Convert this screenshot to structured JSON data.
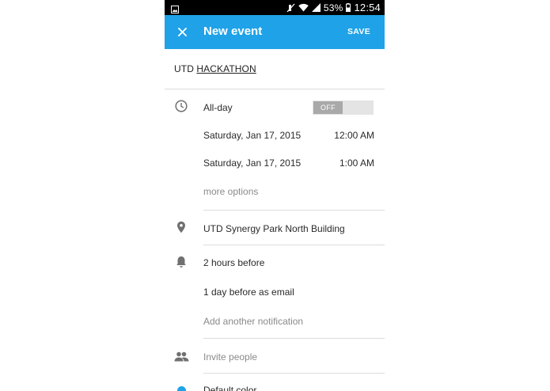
{
  "status_bar": {
    "battery_percent": "53%",
    "time": "12:54",
    "icons": [
      "image-icon",
      "mute-icon",
      "wifi-icon",
      "signal-icon",
      "battery-icon"
    ]
  },
  "app_bar": {
    "close_icon": "close-icon",
    "title": "New event",
    "save_label": "SAVE",
    "background_color": "#1fa2e8"
  },
  "event": {
    "title_prefix": "UTD ",
    "title_underlined": "HACKATHON"
  },
  "time_section": {
    "icon": "clock-icon",
    "all_day_label": "All-day",
    "all_day_toggle": "OFF",
    "start_date": "Saturday, Jan 17, 2015",
    "start_time": "12:00 AM",
    "end_date": "Saturday, Jan 17, 2015",
    "end_time": "1:00 AM",
    "more_options": "more options"
  },
  "location": {
    "icon": "location-pin-icon",
    "value": "UTD Synergy Park North Building"
  },
  "notifications": {
    "icon": "bell-icon",
    "items": [
      "2 hours before",
      "1 day before as email"
    ],
    "add_label": "Add another notification"
  },
  "guests": {
    "icon": "people-icon",
    "placeholder": "Invite people"
  },
  "color": {
    "label": "Default color",
    "value": "#1fa2e8"
  }
}
